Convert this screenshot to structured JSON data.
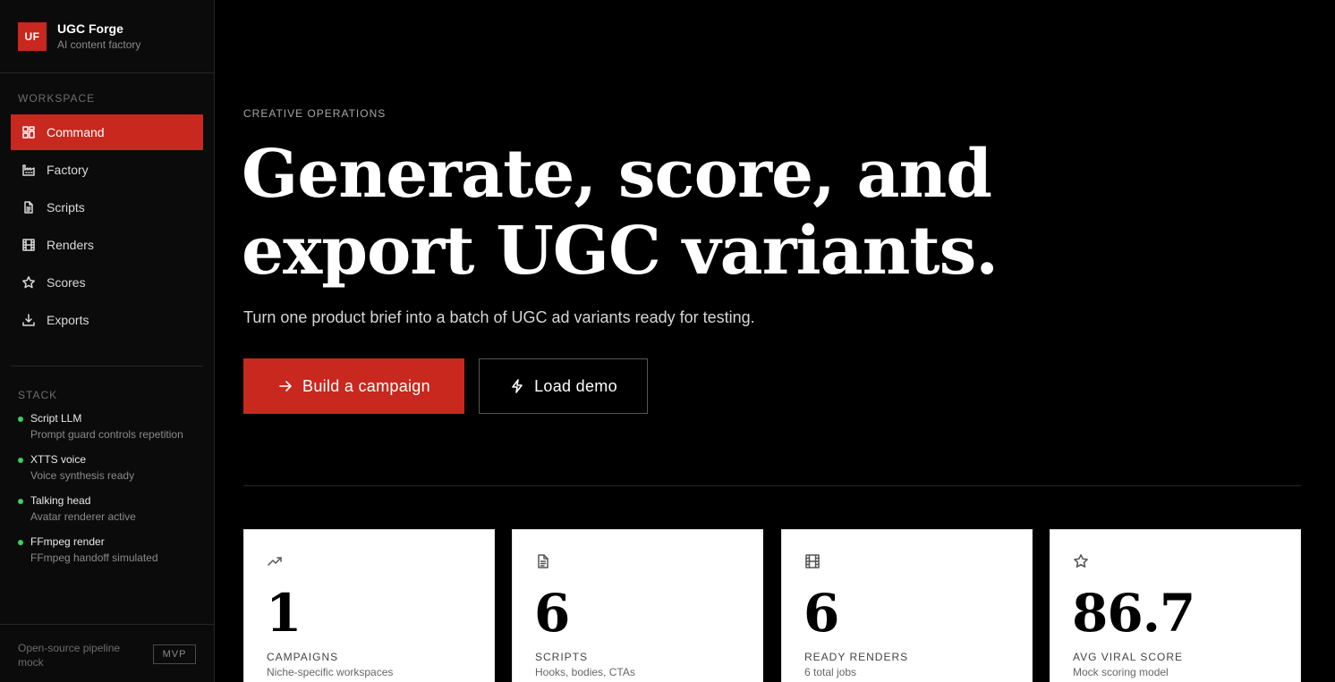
{
  "brand": {
    "logo": "UF",
    "name": "UGC Forge",
    "tagline": "AI content factory"
  },
  "sidebar": {
    "workspace_label": "WORKSPACE",
    "nav": [
      {
        "label": "Command",
        "icon": "dashboard-icon",
        "active": true
      },
      {
        "label": "Factory",
        "icon": "factory-icon",
        "active": false
      },
      {
        "label": "Scripts",
        "icon": "document-icon",
        "active": false
      },
      {
        "label": "Renders",
        "icon": "film-icon",
        "active": false
      },
      {
        "label": "Scores",
        "icon": "star-icon",
        "active": false
      },
      {
        "label": "Exports",
        "icon": "download-icon",
        "active": false
      }
    ],
    "stack_label": "STACK",
    "stack": [
      {
        "title": "Script LLM",
        "desc": "Prompt guard controls repetition",
        "status_color": "#3ecf5c"
      },
      {
        "title": "XTTS voice",
        "desc": "Voice synthesis ready",
        "status_color": "#3ecf5c"
      },
      {
        "title": "Talking head",
        "desc": "Avatar renderer active",
        "status_color": "#3ecf5c"
      },
      {
        "title": "FFmpeg render",
        "desc": "FFmpeg handoff simulated",
        "status_color": "#3ecf5c"
      }
    ],
    "footer_text": "Open-source pipeline mock",
    "footer_badge": "MVP"
  },
  "hero": {
    "eyebrow": "CREATIVE OPERATIONS",
    "headline": "Generate, score, and export UGC variants.",
    "lede": "Turn one product brief into a batch of UGC ad variants ready for testing.",
    "primary_cta": "Build a campaign",
    "secondary_cta": "Load demo"
  },
  "stats": [
    {
      "icon": "trending-up-icon",
      "value": "1",
      "label": "CAMPAIGNS",
      "sub": "Niche-specific workspaces"
    },
    {
      "icon": "document-icon",
      "value": "6",
      "label": "SCRIPTS",
      "sub": "Hooks, bodies, CTAs"
    },
    {
      "icon": "film-icon",
      "value": "6",
      "label": "READY RENDERS",
      "sub": "6 total jobs"
    },
    {
      "icon": "star-icon",
      "value": "86.7",
      "label": "AVG VIRAL SCORE",
      "sub": "Mock scoring model"
    }
  ],
  "colors": {
    "accent": "#c8281e",
    "status_ok": "#3ecf5c",
    "background": "#000000"
  }
}
